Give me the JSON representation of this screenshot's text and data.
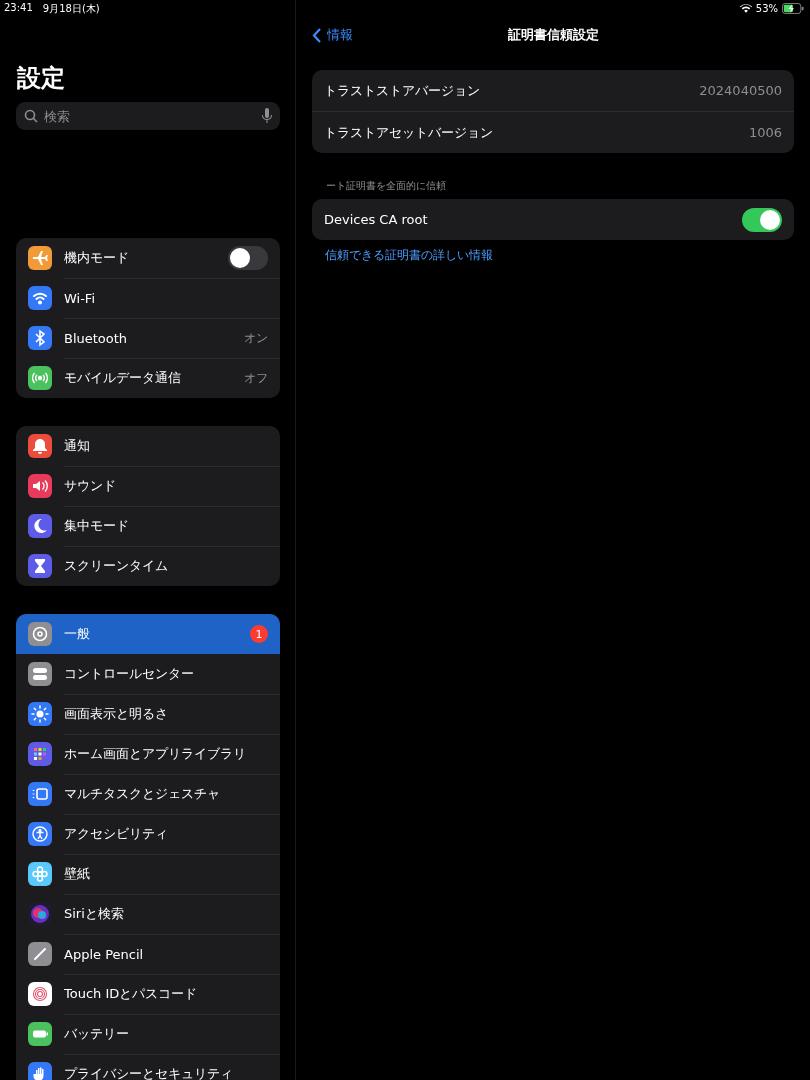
{
  "status_bar": {
    "time": "23:41",
    "date": "9月18日(木)",
    "battery": "53%"
  },
  "sidebar": {
    "title": "設定",
    "search": {
      "placeholder": "検索"
    },
    "groups": [
      [
        {
          "label": "機内モード",
          "kind": "airplane",
          "color": "#f19a37",
          "on": false,
          "selected": false
        },
        {
          "label": "Wi-Fi",
          "kind": "wifi",
          "color": "#3478f6",
          "selected": false
        },
        {
          "label": "Bluetooth",
          "kind": "bluetooth",
          "color": "#3478f6",
          "value": "オン",
          "selected": false
        },
        {
          "label": "モバイルデータ通信",
          "kind": "cellular",
          "color": "#4cc25f",
          "value": "オフ",
          "selected": false
        }
      ],
      [
        {
          "label": "通知",
          "kind": "bell",
          "color": "#eb4d3d",
          "selected": false
        },
        {
          "label": "サウンド",
          "kind": "speaker",
          "color": "#e83a5b",
          "selected": false
        },
        {
          "label": "集中モード",
          "kind": "moon",
          "color": "#5e5ce6",
          "selected": false
        },
        {
          "label": "スクリーンタイム",
          "kind": "hourglass",
          "color": "#5e5ce6",
          "selected": false
        }
      ],
      [
        {
          "label": "一般",
          "kind": "gear",
          "color": "#8e8e93",
          "badge": "1",
          "selected": true
        },
        {
          "label": "コントロールセンター",
          "kind": "switches",
          "color": "#8e8e93",
          "selected": false
        },
        {
          "label": "画面表示と明るさ",
          "kind": "sun",
          "color": "#3478f6",
          "selected": false
        },
        {
          "label": "ホーム画面とアプリライブラリ",
          "kind": "grid",
          "color": "#5e5ce6",
          "selected": false
        },
        {
          "label": "マルチタスクとジェスチャ",
          "kind": "multitask",
          "color": "#3478f6",
          "selected": false
        },
        {
          "label": "アクセシビリティ",
          "kind": "person",
          "color": "#3478f6",
          "selected": false
        },
        {
          "label": "壁紙",
          "kind": "flower",
          "color": "#5ac8fa",
          "selected": false
        },
        {
          "label": "Siriと検索",
          "kind": "orb",
          "color": "#1c1c2e",
          "selected": false
        },
        {
          "label": "Apple Pencil",
          "kind": "pencil",
          "color": "#8e8e93",
          "selected": false
        },
        {
          "label": "Touch IDとパスコード",
          "kind": "fingerprint",
          "color": "#ffffff",
          "selected": false
        },
        {
          "label": "バッテリー",
          "kind": "battery",
          "color": "#4cc25f",
          "selected": false
        },
        {
          "label": "プライバシーとセキュリティ",
          "kind": "hand",
          "color": "#3478f6",
          "selected": false
        }
      ]
    ]
  },
  "detail": {
    "back": "情報",
    "title": "証明書信頼設定",
    "versions": [
      {
        "label": "トラストストアバージョン",
        "value": "2024040500"
      },
      {
        "label": "トラストアセットバージョン",
        "value": "1006"
      }
    ],
    "trust_header": "ート証明書を全面的に信頼",
    "certificates": [
      {
        "label": "Devices CA root",
        "on": true
      }
    ],
    "footer_link": "信頼できる証明書の詳しい情報"
  }
}
